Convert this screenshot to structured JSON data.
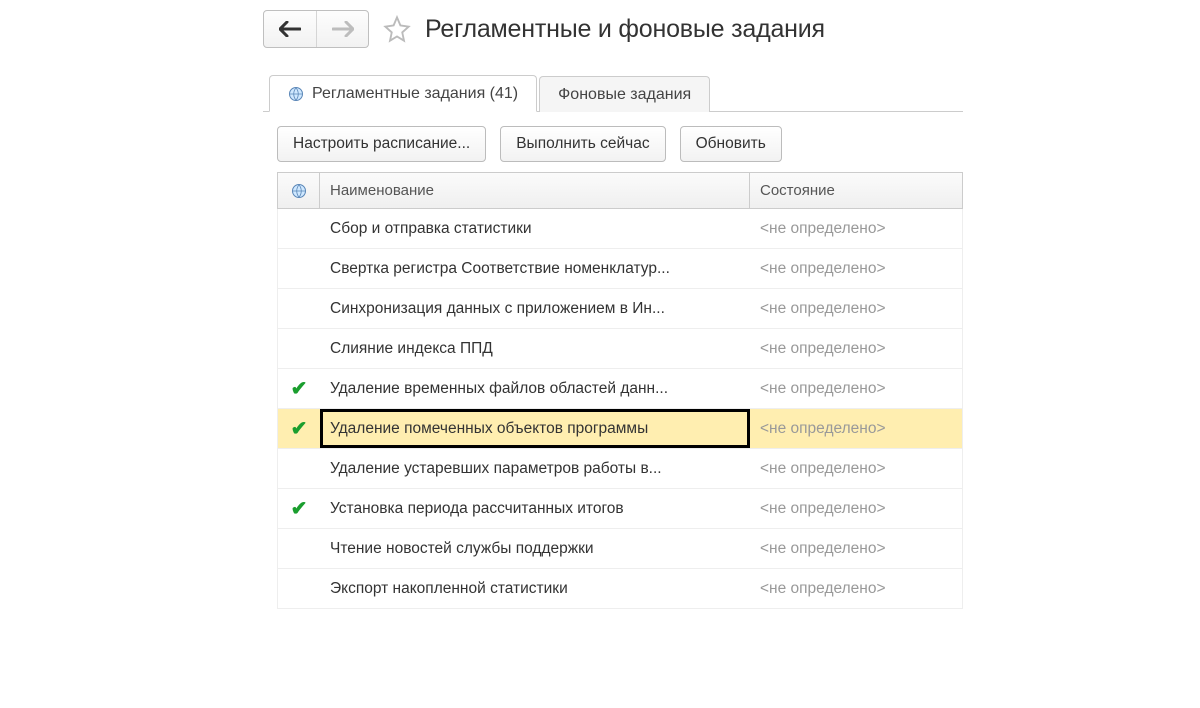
{
  "header": {
    "title": "Регламентные и фоновые задания"
  },
  "tabs": {
    "scheduled": "Регламентные задания (41)",
    "background": "Фоновые задания"
  },
  "toolbar": {
    "configure": "Настроить расписание...",
    "run_now": "Выполнить сейчас",
    "refresh": "Обновить"
  },
  "table": {
    "columns": {
      "name": "Наименование",
      "state": "Состояние"
    },
    "state_undef": "<не определено>",
    "rows": [
      {
        "name": "Сбор и отправка статистики",
        "enabled": false,
        "selected": false
      },
      {
        "name": "Свертка регистра Соответствие номенклатур...",
        "enabled": false,
        "selected": false
      },
      {
        "name": "Синхронизация данных с приложением в Ин...",
        "enabled": false,
        "selected": false
      },
      {
        "name": "Слияние индекса ППД",
        "enabled": false,
        "selected": false
      },
      {
        "name": "Удаление временных файлов областей данн...",
        "enabled": true,
        "selected": false
      },
      {
        "name": "Удаление помеченных объектов программы",
        "enabled": true,
        "selected": true
      },
      {
        "name": "Удаление устаревших параметров работы в...",
        "enabled": false,
        "selected": false
      },
      {
        "name": "Установка периода рассчитанных итогов",
        "enabled": true,
        "selected": false
      },
      {
        "name": "Чтение новостей службы поддержки",
        "enabled": false,
        "selected": false
      },
      {
        "name": "Экспорт накопленной статистики",
        "enabled": false,
        "selected": false
      }
    ]
  }
}
